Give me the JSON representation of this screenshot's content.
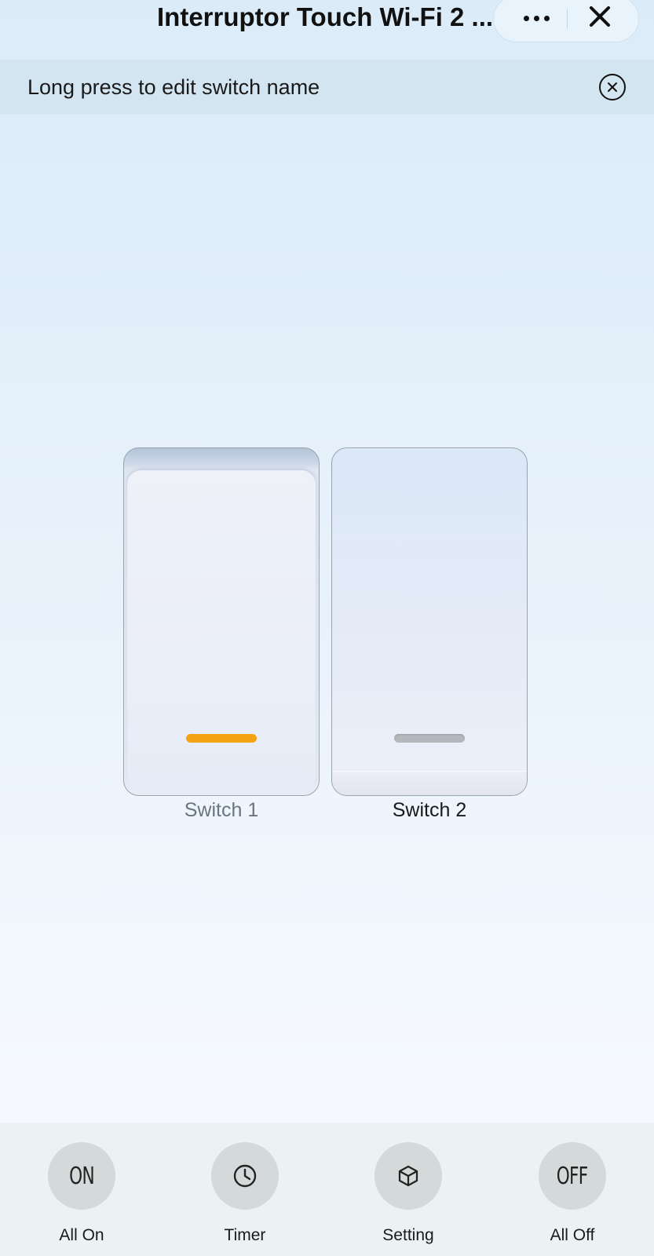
{
  "header": {
    "title": "Interruptor Touch Wi-Fi 2 ..."
  },
  "banner": {
    "text": "Long press to edit switch name"
  },
  "switches": [
    {
      "label": "Switch 1",
      "state": "on",
      "indicator_color": "#f4a412"
    },
    {
      "label": "Switch 2",
      "state": "off",
      "indicator_color": "#b4b8bd"
    }
  ],
  "actions": [
    {
      "glyph": "ON",
      "label": "All On",
      "icon": "on-icon"
    },
    {
      "glyph": "",
      "label": "Timer",
      "icon": "clock-icon"
    },
    {
      "glyph": "",
      "label": "Setting",
      "icon": "cube-icon"
    },
    {
      "glyph": "OFF",
      "label": "All Off",
      "icon": "off-icon"
    }
  ]
}
